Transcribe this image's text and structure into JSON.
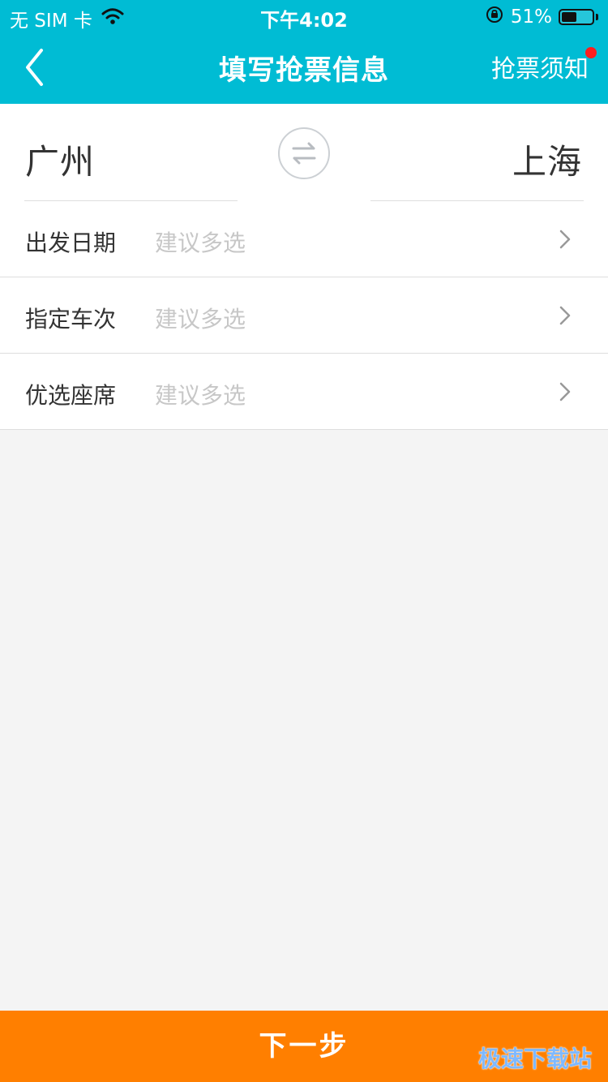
{
  "status_bar": {
    "carrier": "无 SIM 卡",
    "time": "下午4:02",
    "battery_percent": "51%",
    "battery_level": 0.51,
    "icons": [
      "wifi-icon",
      "rotation-lock-icon",
      "battery-icon"
    ]
  },
  "nav": {
    "title": "填写抢票信息",
    "back_icon": "chevron-left-icon",
    "notice_label": "抢票须知",
    "notice_dot_color": "#ff1e1e"
  },
  "route": {
    "from_city": "广州",
    "to_city": "上海",
    "swap_icon": "swap-arrows-icon"
  },
  "form": {
    "rows": [
      {
        "label": "出发日期",
        "placeholder": "建议多选"
      },
      {
        "label": "指定车次",
        "placeholder": "建议多选"
      },
      {
        "label": "优选座席",
        "placeholder": "建议多选"
      }
    ],
    "chevron_icon": "chevron-right-icon"
  },
  "footer": {
    "next_label": "下一步",
    "watermark": "极速下载站"
  },
  "colors": {
    "header": "#00bcd4",
    "primary_button": "#ff7f00",
    "background": "#f4f4f4",
    "placeholder": "#c7c7c7"
  }
}
